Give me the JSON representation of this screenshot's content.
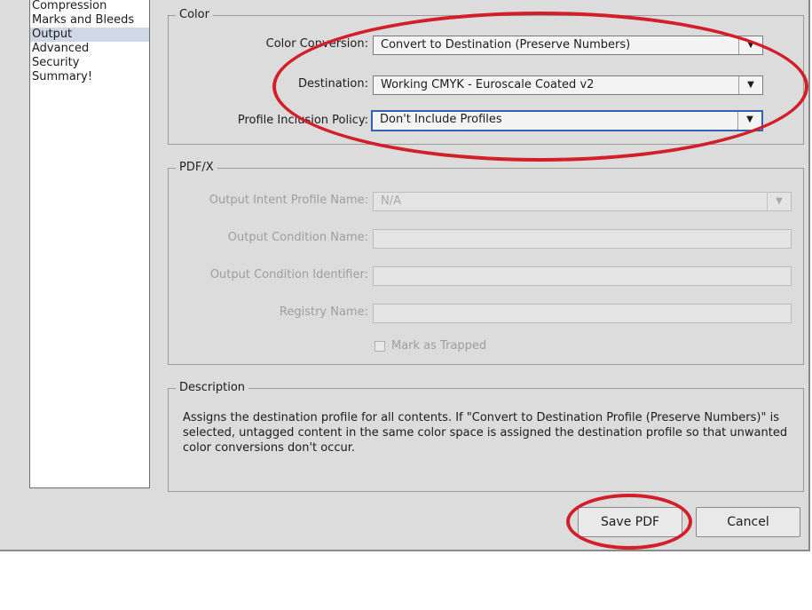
{
  "sidebar": {
    "items": [
      {
        "label": "Compression",
        "active": false
      },
      {
        "label": "Marks and Bleeds",
        "active": false
      },
      {
        "label": "Output",
        "active": true
      },
      {
        "label": "Advanced",
        "active": false
      },
      {
        "label": "Security",
        "active": false
      },
      {
        "label": "Summary!",
        "active": false
      }
    ]
  },
  "color_group": {
    "legend": "Color",
    "color_conversion": {
      "label": "Color Conversion:",
      "value": "Convert to Destination (Preserve Numbers)"
    },
    "destination": {
      "label": "Destination:",
      "value": "Working CMYK - Euroscale Coated v2"
    },
    "profile_inclusion": {
      "label": "Profile Inclusion Policy:",
      "value": "Don't Include Profiles"
    }
  },
  "pdfx_group": {
    "legend": "PDF/X",
    "output_intent": {
      "label": "Output Intent Profile Name:",
      "value": "N/A"
    },
    "output_condition_name": {
      "label": "Output Condition Name:",
      "value": ""
    },
    "output_condition_identifier": {
      "label": "Output Condition Identifier:",
      "value": ""
    },
    "registry_name": {
      "label": "Registry Name:",
      "value": ""
    },
    "mark_as_trapped": {
      "label": "Mark as Trapped",
      "checked": false
    }
  },
  "description_group": {
    "legend": "Description",
    "text": "Assigns the destination profile for all contents. If \"Convert to Destination Profile (Preserve Numbers)\" is selected, untagged content in the same color space is assigned the destination profile so that unwanted color conversions don't occur."
  },
  "buttons": {
    "save_label": "Save PDF",
    "cancel_label": "Cancel"
  },
  "annotations": {
    "ring_color": "#d21f2a"
  },
  "dropdown_arrow": "▼"
}
